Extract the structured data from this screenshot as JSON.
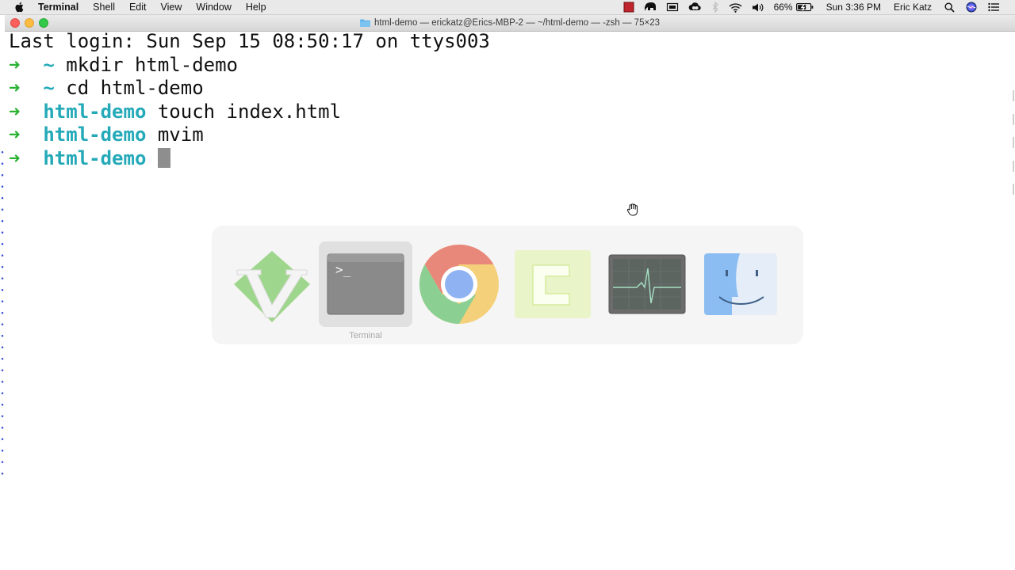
{
  "menubar": {
    "app_name": "Terminal",
    "items": [
      "Shell",
      "Edit",
      "View",
      "Window",
      "Help"
    ],
    "status": {
      "battery_percent": "66%",
      "clock": "Sun 3:36 PM",
      "user": "Eric Katz"
    }
  },
  "window": {
    "title": "html-demo — erickatz@Erics-MBP-2 — ~/html-demo — -zsh — 75×23"
  },
  "terminal": {
    "last_login": "Last login: Sun Sep 15 08:50:17 on ttys003",
    "lines": [
      {
        "arrow": "➜",
        "dir": "~",
        "command": "mkdir html-demo"
      },
      {
        "arrow": "➜",
        "dir": "~",
        "command": "cd html-demo"
      },
      {
        "arrow": "➜",
        "dir": "html-demo",
        "command": "touch index.html"
      },
      {
        "arrow": "➜",
        "dir": "html-demo",
        "command": "mvim"
      },
      {
        "arrow": "➜",
        "dir": "html-demo",
        "command": ""
      }
    ]
  },
  "app_switcher": {
    "apps": [
      "vim",
      "terminal",
      "chrome",
      "camtasia",
      "activity-monitor",
      "finder"
    ],
    "selected_label": "Terminal"
  },
  "colors": {
    "prompt_arrow": "#2bb232",
    "prompt_dir": "#24a9b8"
  }
}
